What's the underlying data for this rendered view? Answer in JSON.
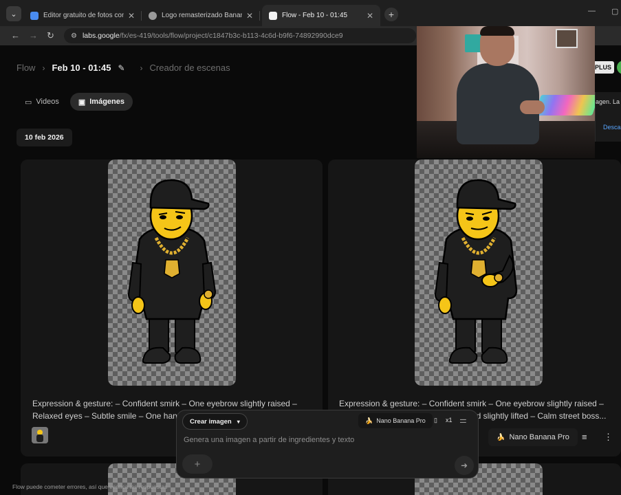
{
  "browser": {
    "tabs": [
      {
        "label": "Editor gratuito de fotos con IA",
        "favicon_color": "#4a8cf0",
        "active": false
      },
      {
        "label": "Logo remasterizado Banana Pro",
        "favicon_color": "#9a9a9a",
        "active": false
      },
      {
        "label": "Flow - Feb 10 - 01:45",
        "favicon_color": "#f2f2f2",
        "active": true
      }
    ],
    "new_tab": "+",
    "url_host": "labs.google",
    "url_path": "/fx/es-419/tools/flow/project/c1847b3c-b113-4c6d-b9f6-74892990dce9"
  },
  "breadcrumb": {
    "root": "Flow",
    "project": "Feb 10 - 01:45",
    "section": "Creador de escenas"
  },
  "header_right": {
    "plan_badge": "PLUS"
  },
  "filter": {
    "videos": "Videos",
    "images": "Imágenes"
  },
  "date_chip": "10 feb 2026",
  "cards": [
    {
      "caption_line1": "Expression & gesture: – Confident smirk – One eyebrow slightly raised –",
      "caption_line2": "Relaxed eyes – Subtle smile – One hand"
    },
    {
      "caption_line1": "Expression & gesture: – Confident smirk – One eyebrow slightly raised –",
      "caption_line2": "nd slightly lifted – Calm street boss..."
    }
  ],
  "card_model": "Nano Banana Pro",
  "composer": {
    "mode": "Crear imagen",
    "model": "Nano Banana Pro",
    "count": "x1",
    "placeholder": "Genera una imagen a partir de ingredientes y texto"
  },
  "footnote": "Flow puede cometer errores, así que verifica las respuestas",
  "side_panel": {
    "text": "agen. La",
    "link": "Descar"
  },
  "colors": {
    "background": "#0a0a0a",
    "card": "#161616",
    "character_skin": "#f5c518",
    "hoodie": "#1e1e1e",
    "gold": "#e0b030",
    "link": "#59a6ff"
  }
}
